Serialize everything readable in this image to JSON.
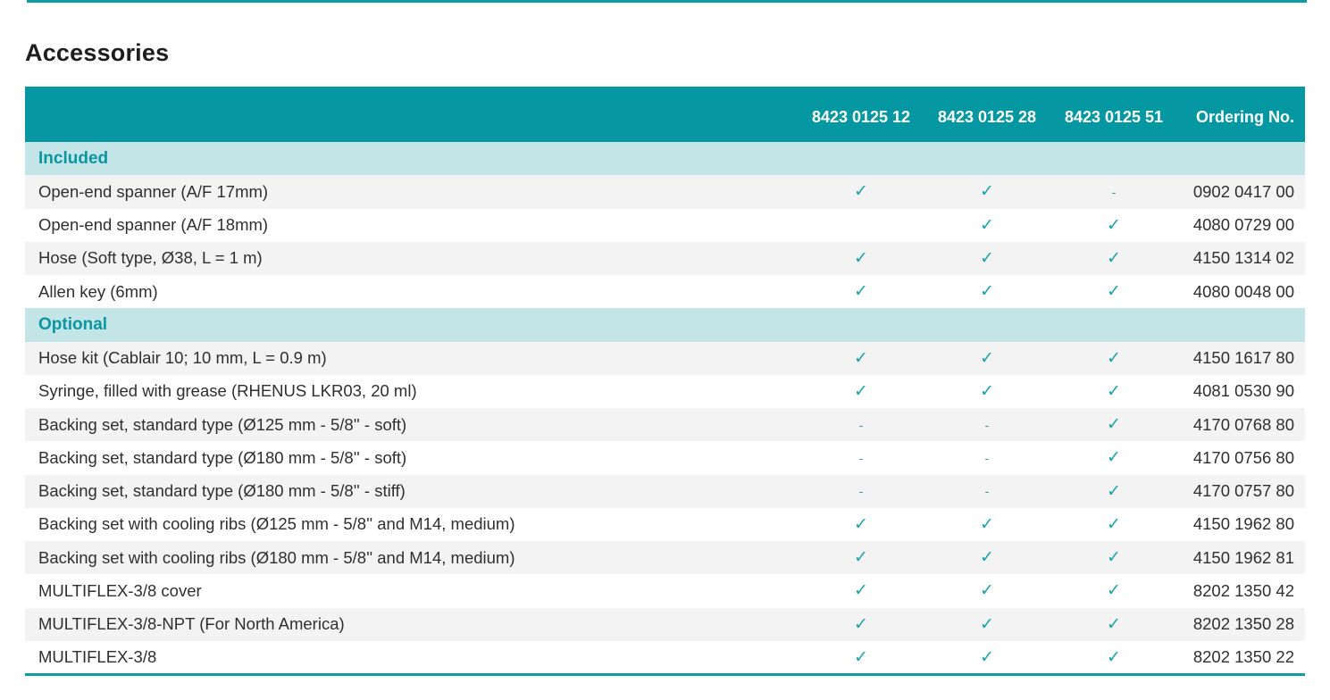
{
  "page": {
    "title": "Accessories"
  },
  "table": {
    "headers": [
      "",
      "8423 0125 12",
      "8423 0125 28",
      "8423 0125 51",
      "Ordering No."
    ],
    "sections": [
      {
        "label": "Included",
        "rows": [
          {
            "name": "Open-end spanner (A/F 17mm)",
            "marks": [
              "✓",
              "✓",
              "-"
            ],
            "ordering_no": "0902 0417 00"
          },
          {
            "name": "Open-end spanner (A/F 18mm)",
            "marks": [
              "",
              "✓",
              "✓"
            ],
            "ordering_no": "4080 0729 00"
          },
          {
            "name": "Hose (Soft type, Ø38, L = 1 m)",
            "marks": [
              "✓",
              "✓",
              "✓"
            ],
            "ordering_no": "4150 1314 02"
          },
          {
            "name": "Allen key (6mm)",
            "marks": [
              "✓",
              "✓",
              "✓"
            ],
            "ordering_no": "4080 0048 00"
          }
        ]
      },
      {
        "label": "Optional",
        "rows": [
          {
            "name": "Hose kit (Cablair 10; 10 mm, L = 0.9 m)",
            "marks": [
              "✓",
              "✓",
              "✓"
            ],
            "ordering_no": "4150 1617 80"
          },
          {
            "name": "Syringe, filled with grease (RHENUS LKR03, 20 ml)",
            "marks": [
              "✓",
              "✓",
              "✓"
            ],
            "ordering_no": "4081 0530 90"
          },
          {
            "name": "Backing set, standard type (Ø125 mm - 5/8'' - soft)",
            "marks": [
              "-",
              "-",
              "✓"
            ],
            "ordering_no": "4170 0768 80"
          },
          {
            "name": "Backing set, standard type (Ø180 mm - 5/8'' - soft)",
            "marks": [
              "-",
              "-",
              "✓"
            ],
            "ordering_no": "4170 0756 80"
          },
          {
            "name": "Backing set, standard type (Ø180 mm - 5/8'' - stiff)",
            "marks": [
              "-",
              "-",
              "✓"
            ],
            "ordering_no": "4170 0757 80"
          },
          {
            "name": "Backing set with cooling ribs (Ø125 mm - 5/8'' and M14, medium)",
            "marks": [
              "✓",
              "✓",
              "✓"
            ],
            "ordering_no": "4150 1962 80"
          },
          {
            "name": "Backing set with cooling ribs (Ø180 mm - 5/8'' and M14, medium)",
            "marks": [
              "✓",
              "✓",
              "✓"
            ],
            "ordering_no": "4150 1962 81"
          },
          {
            "name": "MULTIFLEX-3/8 cover",
            "marks": [
              "✓",
              "✓",
              "✓"
            ],
            "ordering_no": "8202 1350 42"
          },
          {
            "name": "MULTIFLEX-3/8-NPT (For North America)",
            "marks": [
              "✓",
              "✓",
              "✓"
            ],
            "ordering_no": "8202 1350 28"
          },
          {
            "name": "MULTIFLEX-3/8",
            "marks": [
              "✓",
              "✓",
              "✓"
            ],
            "ordering_no": "8202 1350 22"
          }
        ]
      }
    ]
  },
  "colors": {
    "accent": "#0598a2",
    "section_bg": "#c4e5e7",
    "alt_row": "#f3f3f3",
    "mark": "#19a3ab"
  }
}
